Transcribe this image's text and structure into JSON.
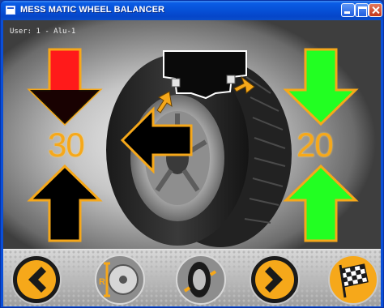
{
  "window": {
    "title": "MESS MATIC WHEEL BALANCER"
  },
  "status": {
    "user_label": "User: 1 - Alu-1"
  },
  "balance": {
    "left_value": "30",
    "right_value": "20"
  },
  "colors": {
    "accent_orange": "#f6a81a",
    "arrow_red": "#ff1a1a",
    "arrow_green": "#22ff22",
    "arrow_black": "#000000"
  },
  "icons": {
    "left_top_arrow": "arrow-down-red-icon",
    "left_bottom_arrow": "arrow-up-black-icon",
    "right_top_arrow": "arrow-down-green-icon",
    "right_bottom_arrow": "arrow-up-green-icon",
    "center_arrow": "arrow-left-black-icon",
    "toolbar": [
      "back-chevron-icon",
      "rim-dimension-icon",
      "tire-measure-icon",
      "forward-chevron-icon",
      "checkered-flag-icon"
    ]
  }
}
